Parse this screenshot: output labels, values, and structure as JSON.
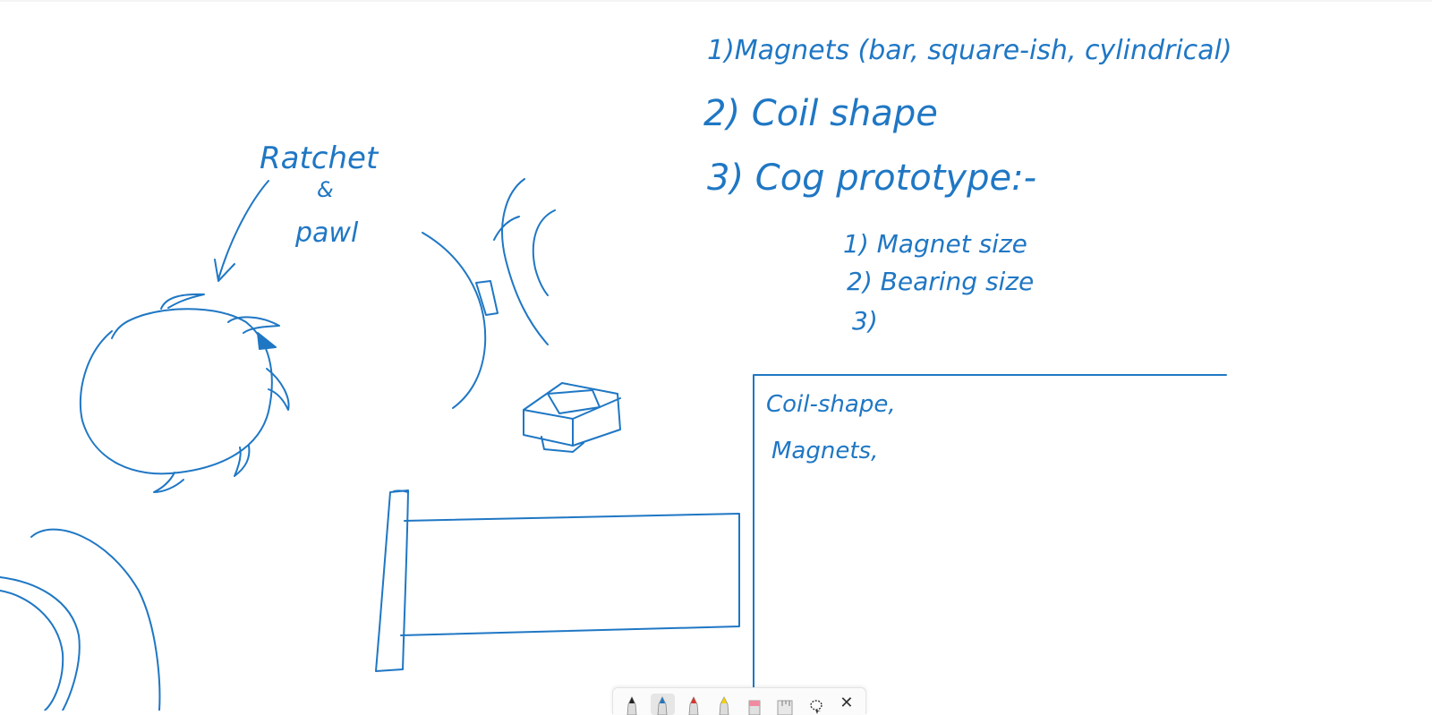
{
  "ink_color": "#1f77c4",
  "notes": {
    "line1": "1)Magnets (bar, square-ish, cylindrical)",
    "line2": "2) Coil shape",
    "line3": "3) Cog prototype:-",
    "sub1": "1) Magnet size",
    "sub2": "2) Bearing size",
    "sub3": "3)"
  },
  "sketch_label": {
    "line1": "Ratchet",
    "line2": "&",
    "line3": "pawl"
  },
  "box_notes": {
    "line1": "Coil-shape,",
    "line2": "Magnets,"
  },
  "toolbar": {
    "tools": [
      {
        "name": "pen-black-tool-icon",
        "tip_color": "#222222",
        "selected": false
      },
      {
        "name": "pen-blue-tool-icon",
        "tip_color": "#1f77c4",
        "selected": true
      },
      {
        "name": "pen-red-tool-icon",
        "tip_color": "#d9342b",
        "selected": false
      },
      {
        "name": "highlighter-yellow-icon",
        "tip_color": "#f5d300",
        "selected": false
      },
      {
        "name": "eraser-icon",
        "tip_color": "#f08aa0",
        "selected": false
      },
      {
        "name": "ruler-icon",
        "tip_color": "#9e9e9e",
        "selected": false
      },
      {
        "name": "lasso-select-icon",
        "tip_color": "#333333",
        "selected": false
      }
    ],
    "close_label": "✕"
  }
}
